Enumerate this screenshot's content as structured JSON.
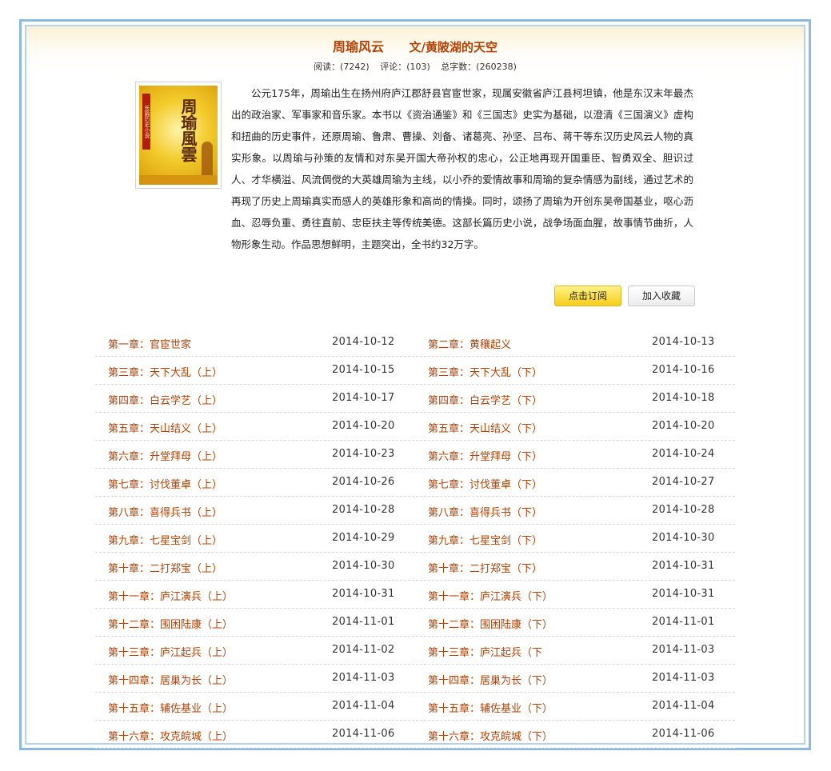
{
  "book": {
    "title": "周瑜风云",
    "author": "文/黄陂湖的天空",
    "stats": {
      "reads_label": "阅读：(7242)",
      "comments_label": "评论：(103)",
      "words_label": "总字数：(260238)"
    },
    "cover": {
      "title_text": "周瑜風雲",
      "strip_text": "长篇历史小说"
    },
    "description": "公元175年，周瑜出生在扬州府庐江郡舒县官宦世家，现属安徽省庐江县柯坦镇，他是东汉末年最杰出的政治家、军事家和音乐家。本书以《资治通鉴》和《三国志》史实为基础，以澄清《三国演义》虚构和扭曲的历史事件，还原周瑜、鲁肃、曹操、刘备、诸葛亮、孙坚、吕布、蒋干等东汉历史风云人物的真实形象。以周瑜与孙策的友情和对东吴开国大帝孙权的忠心，公正地再现开国重臣、智勇双全、胆识过人、才华横溢、风流倜傥的大英雄周瑜为主线，以小乔的爱情故事和周瑜的复杂情感为副线，通过艺术的再现了历史上周瑜真实而感人的英雄形象和高尚的情操。同时，颂扬了周瑜为开创东吴帝国基业，呕心沥血、忍辱负重、勇往直前、忠臣扶主等传统美德。这部长篇历史小说，战争场面血腥，故事情节曲折，人物形象生动。作品思想鲜明，主题突出，全书约32万字。"
  },
  "actions": {
    "subscribe_label": "点击订阅",
    "favorite_label": "加入收藏"
  },
  "chapters": [
    {
      "left": {
        "title": "第一章：官宦世家",
        "date": "2014-10-12"
      },
      "right": {
        "title": "第二章：黄穰起义",
        "date": "2014-10-13"
      }
    },
    {
      "left": {
        "title": "第三章：天下大乱（上）",
        "date": "2014-10-15"
      },
      "right": {
        "title": "第三章：天下大乱（下）",
        "date": "2014-10-16"
      }
    },
    {
      "left": {
        "title": "第四章：白云学艺（上）",
        "date": "2014-10-17"
      },
      "right": {
        "title": "第四章：白云学艺（下）",
        "date": "2014-10-18"
      }
    },
    {
      "left": {
        "title": "第五章：天山结义（上）",
        "date": "2014-10-20"
      },
      "right": {
        "title": "第五章：天山结义（下）",
        "date": "2014-10-20"
      }
    },
    {
      "left": {
        "title": "第六章：升堂拜母（上）",
        "date": "2014-10-23"
      },
      "right": {
        "title": "第六章：升堂拜母（下）",
        "date": "2014-10-24"
      }
    },
    {
      "left": {
        "title": "第七章：讨伐董卓（上）",
        "date": "2014-10-26"
      },
      "right": {
        "title": "第七章：讨伐董卓（下）",
        "date": "2014-10-27"
      }
    },
    {
      "left": {
        "title": "第八章：喜得兵书（上）",
        "date": "2014-10-28"
      },
      "right": {
        "title": "第八章：喜得兵书（下）",
        "date": "2014-10-28"
      }
    },
    {
      "left": {
        "title": "第九章：七星宝剑（上）",
        "date": "2014-10-29"
      },
      "right": {
        "title": "第九章：七星宝剑（下）",
        "date": "2014-10-30"
      }
    },
    {
      "left": {
        "title": "第十章：二打郑宝（上）",
        "date": "2014-10-30"
      },
      "right": {
        "title": "第十章：二打郑宝（下）",
        "date": "2014-10-31"
      }
    },
    {
      "left": {
        "title": "第十一章：庐江演兵（上）",
        "date": "2014-10-31"
      },
      "right": {
        "title": "第十一章：庐江演兵（下）",
        "date": "2014-10-31"
      }
    },
    {
      "left": {
        "title": "第十二章：围困陆康（上）",
        "date": "2014-11-01"
      },
      "right": {
        "title": "第十二章：围困陆康（下）",
        "date": "2014-11-01"
      }
    },
    {
      "left": {
        "title": "第十三章：庐江起兵（上）",
        "date": "2014-11-02"
      },
      "right": {
        "title": "第十三章：庐江起兵（下",
        "date": "2014-11-03"
      }
    },
    {
      "left": {
        "title": "第十四章：居巢为长（上）",
        "date": "2014-11-03"
      },
      "right": {
        "title": "第十四章：居巢为长（下）",
        "date": "2014-11-03"
      }
    },
    {
      "left": {
        "title": "第十五章：辅佐基业（上）",
        "date": "2014-11-04"
      },
      "right": {
        "title": "第十五章：辅佐基业（下）",
        "date": "2014-11-04"
      }
    },
    {
      "left": {
        "title": "第十六章：攻克皖城（上）",
        "date": "2014-11-06"
      },
      "right": {
        "title": "第十六章：攻克皖城（下）",
        "date": "2014-11-06"
      }
    }
  ]
}
